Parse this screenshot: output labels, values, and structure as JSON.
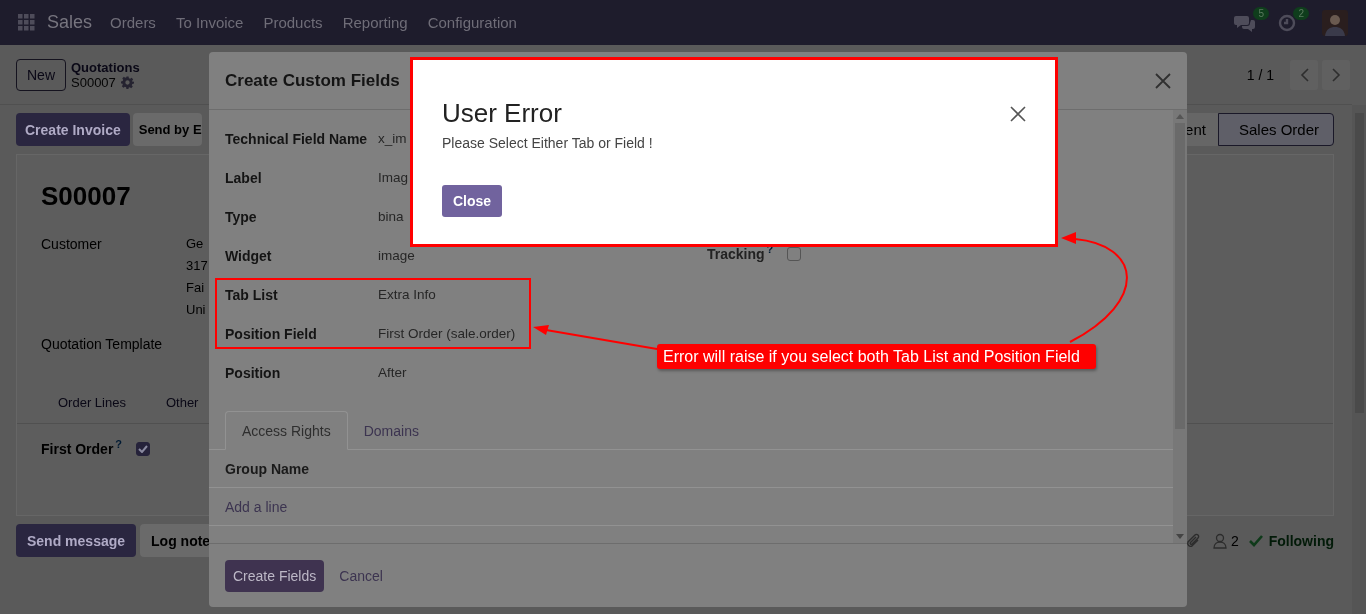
{
  "navbar": {
    "app": "Sales",
    "menu": [
      "Orders",
      "To Invoice",
      "Products",
      "Reporting",
      "Configuration"
    ],
    "messages_badge": "5",
    "activities_badge": "2"
  },
  "control_panel": {
    "new_button": "New",
    "breadcrumb": "Quotations",
    "record": "S00007",
    "pager": "1 / 1"
  },
  "actions": {
    "buttons": [
      "Create Invoice",
      "Send by E"
    ],
    "status_steps": [
      {
        "label": "ent",
        "selected": false
      },
      {
        "label": "Sales Order",
        "selected": true
      }
    ]
  },
  "sheet": {
    "title": "S00007",
    "fields": [
      {
        "label": "Customer",
        "lines": [
          "Ge",
          "317",
          "Fai",
          "Uni"
        ]
      },
      {
        "label": "Quotation Template"
      }
    ],
    "tabs": [
      "Order Lines",
      "Other"
    ],
    "first_order": {
      "label": "First Order",
      "help": "?",
      "checked": true
    }
  },
  "chatter": {
    "buttons": [
      "Send message",
      "Log note"
    ],
    "followers": "2",
    "following": "Following"
  },
  "modal": {
    "title": "Create Custom Fields",
    "fields": [
      {
        "label": "Technical Field Name",
        "value": "x_im"
      },
      {
        "label": "Label",
        "value": "Imag"
      },
      {
        "label": "Type",
        "value": "bina"
      },
      {
        "label": "Widget",
        "value": "image"
      },
      {
        "label": "Tab List",
        "value": "Extra Info"
      },
      {
        "label": "Position Field",
        "value": "First Order (sale.order)"
      },
      {
        "label": "Position",
        "value": "After"
      }
    ],
    "tracking": {
      "label": "Tracking",
      "help": "?",
      "checked": false
    },
    "tabs": [
      {
        "label": "Access Rights",
        "selected": true
      },
      {
        "label": "Domains",
        "selected": false
      }
    ],
    "table": {
      "columns": [
        "Group Name"
      ],
      "add_line": "Add a line"
    },
    "buttons": [
      "Create Fields",
      "Cancel"
    ]
  },
  "error_dialog": {
    "title": "User Error",
    "message": "Please Select Either Tab or Field !",
    "button": "Close"
  },
  "annotation": {
    "note": "Error will raise if you select both Tab List and Position Field"
  }
}
